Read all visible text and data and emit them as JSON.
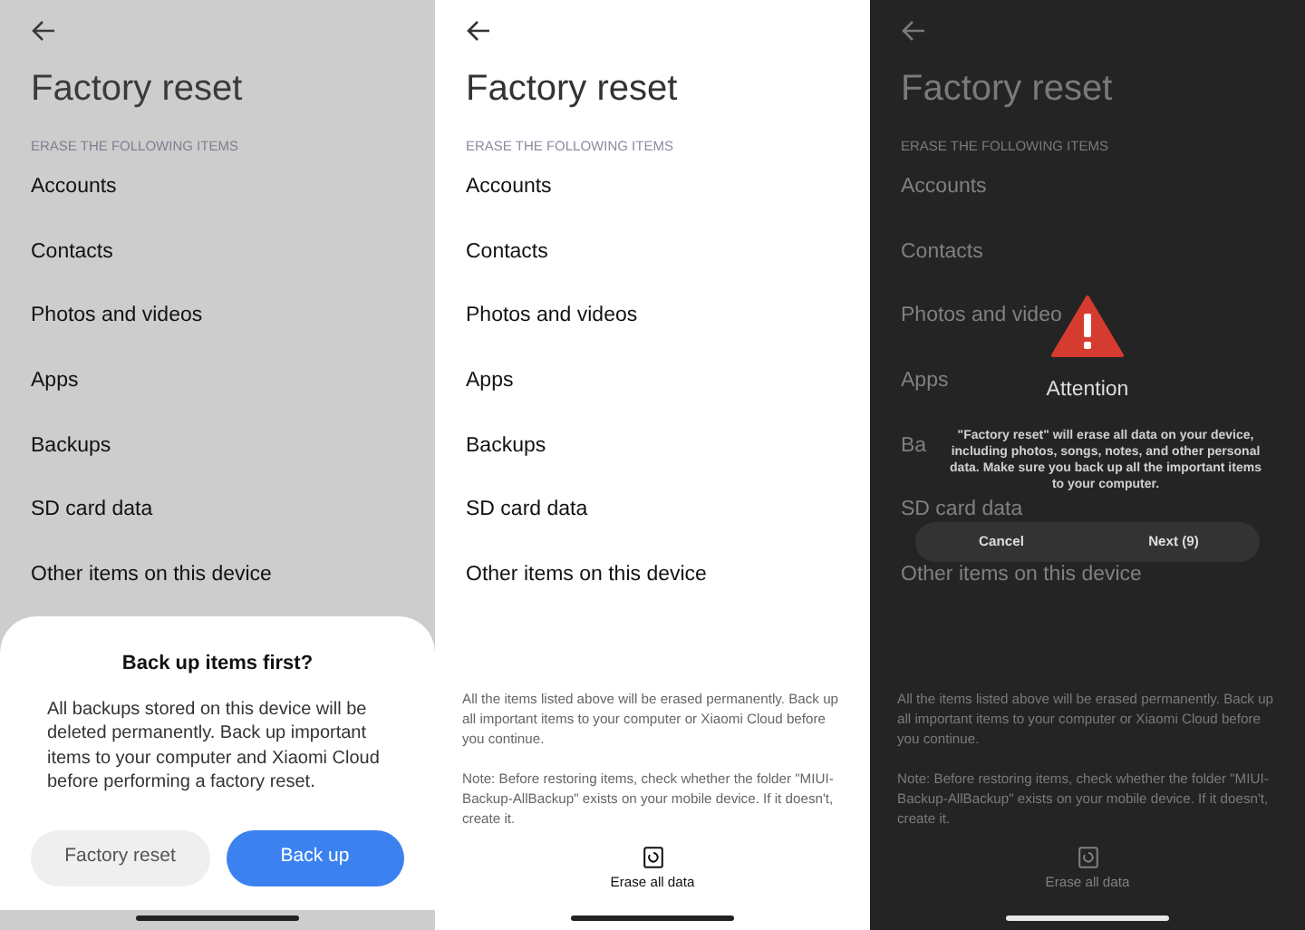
{
  "screens": [
    {
      "kind": "sheet",
      "title": "Factory reset",
      "section": "ERASE THE FOLLOWING ITEMS",
      "items": [
        "Accounts",
        "Contacts",
        "Photos and videos",
        "Apps",
        "Backups",
        "SD card data",
        "Other items on this device"
      ],
      "sheet": {
        "title": "Back up items first?",
        "body": "All backups stored on this device will be deleted permanently. Back up important items to your computer and Xiaomi Cloud before performing a factory reset.",
        "buttons": [
          {
            "label": "Factory reset",
            "primary": false
          },
          {
            "label": "Back up",
            "primary": true
          }
        ]
      }
    },
    {
      "kind": "plain",
      "title": "Factory reset",
      "section": "ERASE THE FOLLOWING ITEMS",
      "items": [
        "Accounts",
        "Contacts",
        "Photos and videos",
        "Apps",
        "Backups",
        "SD card data",
        "Other items on this device"
      ],
      "footer": {
        "notes": [
          "All the items listed above will be erased permanently. Back up all important items to your computer or Xiaomi Cloud before you continue.",
          "Note: Before restoring items, check whether the folder \"MIUI-Backup-AllBackup\" exists on your mobile device. If it doesn't, create it."
        ],
        "action": "Erase all data"
      }
    },
    {
      "kind": "alert",
      "title": "Factory reset",
      "section": "ERASE THE FOLLOWING ITEMS",
      "items": [
        "Accounts",
        "Contacts",
        "Photos and video",
        "Apps",
        "Ba",
        "SD card data",
        "Other items on this device"
      ],
      "footer": {
        "notes": [
          "All the items listed above will be erased permanently. Back up all important items to your computer or Xiaomi Cloud before you continue.",
          "Note: Before restoring items, check whether the folder \"MIUI-Backup-AllBackup\" exists on your mobile device. If it doesn't, create it."
        ],
        "action": "Erase all data"
      },
      "alert": {
        "title": "Attention",
        "body": "\"Factory reset\" will erase all data on your device, including photos, songs, notes, and other personal data. Make sure you back up all the important items to your computer.",
        "buttons": [
          "Cancel",
          "Next (9)"
        ]
      }
    }
  ]
}
